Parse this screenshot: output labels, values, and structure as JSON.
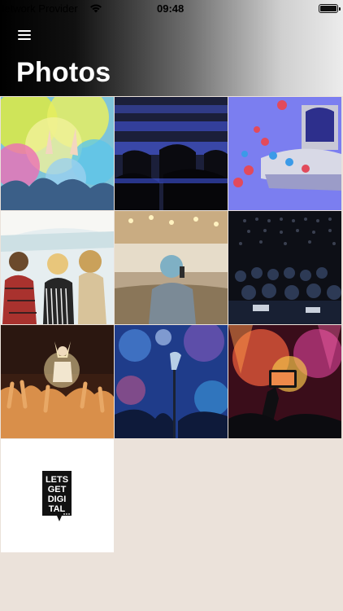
{
  "status_bar": {
    "carrier": "Network Provider",
    "time": "09:48"
  },
  "header": {
    "title": "Photos"
  },
  "photos": [
    {
      "subject": "color powder festival crowd"
    },
    {
      "subject": "empty blue auditorium seats"
    },
    {
      "subject": "virtual stage with like reactions"
    },
    {
      "subject": "festival crowd from behind"
    },
    {
      "subject": "speaker facing audience"
    },
    {
      "subject": "audience in dark hall"
    },
    {
      "subject": "concert crowd hands raised"
    },
    {
      "subject": "microphone on stage bokeh"
    },
    {
      "subject": "phone recording concert"
    },
    {
      "subject": "logo tile"
    }
  ],
  "logo": {
    "lines": [
      "LETS",
      "GET",
      "DIGI",
      "TAL"
    ]
  }
}
